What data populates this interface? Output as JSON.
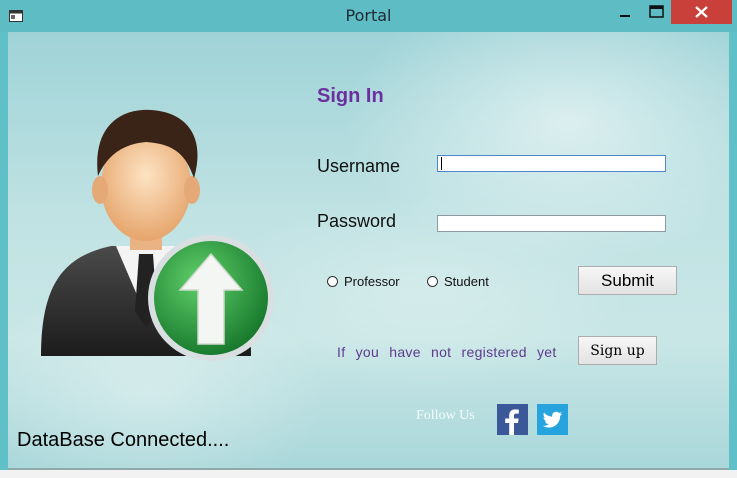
{
  "window": {
    "title": "Portal"
  },
  "form": {
    "heading": "Sign In",
    "username_label": "Username",
    "username_value": "",
    "password_label": "Password",
    "password_value": "",
    "role_options": [
      "Professor",
      "Student"
    ],
    "submit_label": "Submit",
    "register_prompt": "If you have not registered yet",
    "signup_label": "Sign up",
    "follow_label": "Follow Us",
    "status_message": "DataBase Connected...."
  },
  "colors": {
    "heading": "#6b2f9e",
    "facebook": "#3b5998",
    "twitter": "#27a4dd",
    "close_button": "#c9403a",
    "upload_badge": "#2e9a3e"
  },
  "icons": {
    "avatar": "user-upload-icon",
    "facebook": "facebook-icon",
    "twitter": "twitter-icon"
  }
}
